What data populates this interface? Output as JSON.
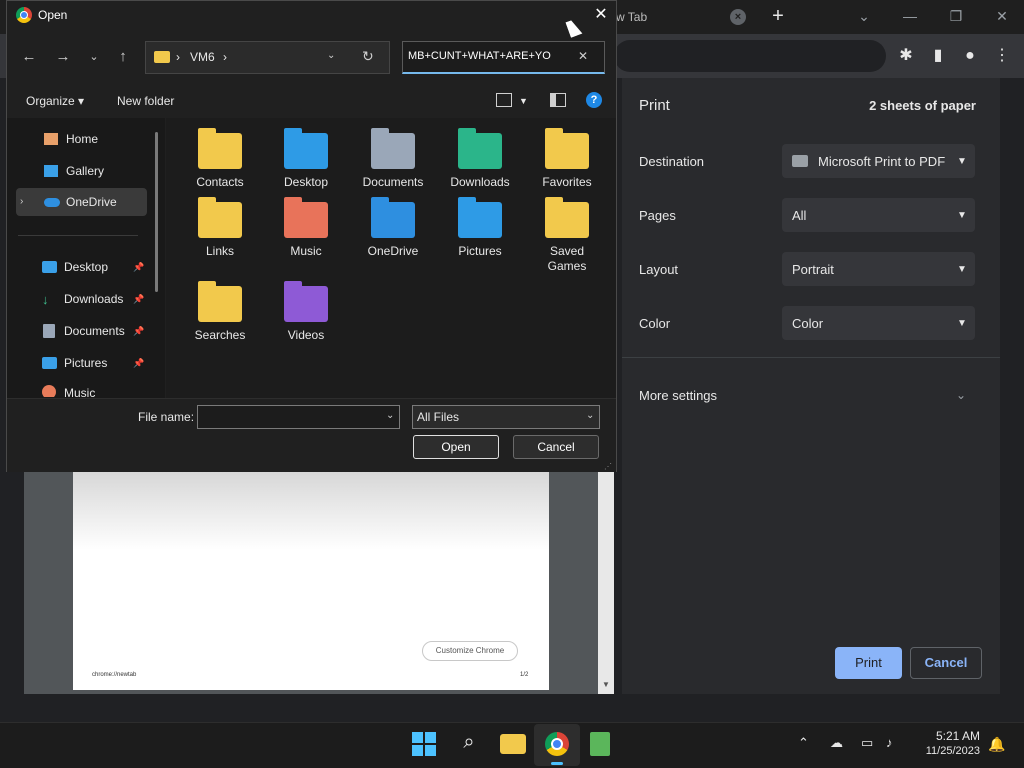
{
  "browser": {
    "tab_title": "New Tab",
    "tab_title_partial": "w Tab",
    "new_tab_icon": "plus-icon",
    "close_icon": "close-icon"
  },
  "print_preview": {
    "title": "Print",
    "sheets": "2 sheets of paper",
    "settings": [
      {
        "label": "Destination",
        "value": "Microsoft Print to PDF"
      },
      {
        "label": "Pages",
        "value": "All"
      },
      {
        "label": "Layout",
        "value": "Portrait"
      },
      {
        "label": "Color",
        "value": "Color"
      }
    ],
    "more_settings": "More settings",
    "print_button": "Print",
    "cancel_button": "Cancel",
    "page_preview": {
      "customize_label": "Customize Chrome",
      "footer_url": "chrome://newtab",
      "footer_page": "1/2"
    }
  },
  "open_dialog": {
    "title": "Open",
    "address": {
      "segments": [
        "VM6"
      ]
    },
    "search_value": "MB+CUNT+WHAT+ARE+YO",
    "commands": {
      "organize": "Organize",
      "new_folder": "New folder"
    },
    "nav": {
      "home": "Home",
      "gallery": "Gallery",
      "onedrive": "OneDrive",
      "quick_access": [
        {
          "label": "Desktop",
          "color": "#3aa0e8"
        },
        {
          "label": "Downloads",
          "color": "#3fbf8f"
        },
        {
          "label": "Documents",
          "color": "#9aa7b8"
        },
        {
          "label": "Pictures",
          "color": "#3aa0e8"
        },
        {
          "label": "Music",
          "color": "#e87c5a"
        }
      ]
    },
    "folders": [
      {
        "label": "Contacts",
        "color": "#f2c94c"
      },
      {
        "label": "Desktop",
        "color": "#2e9be6"
      },
      {
        "label": "Documents",
        "color": "#9aa7b8"
      },
      {
        "label": "Downloads",
        "color": "#2bb58a"
      },
      {
        "label": "Favorites",
        "color": "#f2c94c"
      },
      {
        "label": "Links",
        "color": "#f2c94c"
      },
      {
        "label": "Music",
        "color": "#e8735a"
      },
      {
        "label": "OneDrive",
        "color": "#2e8fe0"
      },
      {
        "label": "Pictures",
        "color": "#2e9be6"
      },
      {
        "label": "Saved Games",
        "color": "#f2c94c"
      },
      {
        "label": "Searches",
        "color": "#f2c94c"
      },
      {
        "label": "Videos",
        "color": "#8e5ad6"
      }
    ],
    "file_name_label": "File name:",
    "file_name_value": "",
    "file_type": "All Files",
    "open_button": "Open",
    "cancel_button": "Cancel"
  },
  "taskbar": {
    "time": "5:21 AM",
    "date": "11/25/2023"
  }
}
